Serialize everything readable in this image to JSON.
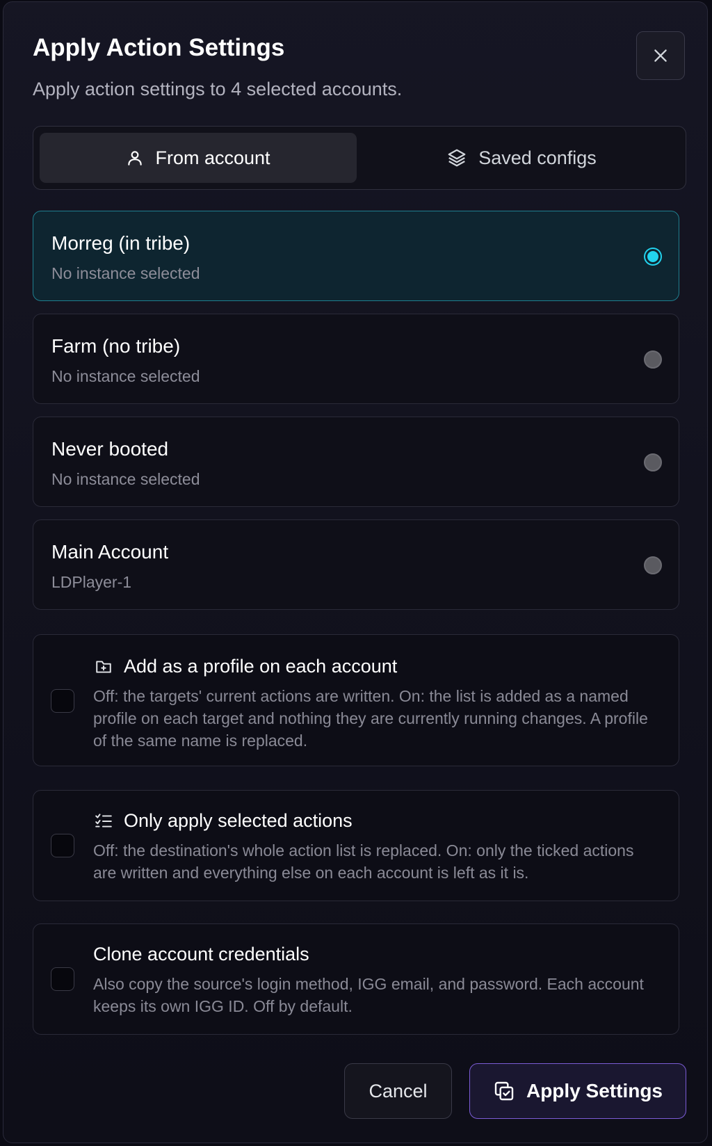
{
  "dialog": {
    "title": "Apply Action Settings",
    "subtitle": "Apply action settings to 4 selected accounts."
  },
  "tabs": [
    {
      "label": "From account",
      "icon": "user-icon",
      "active": true
    },
    {
      "label": "Saved configs",
      "icon": "layers-icon",
      "active": false
    }
  ],
  "accounts": [
    {
      "name": "Morreg (in tribe)",
      "instance": "No instance selected",
      "selected": true
    },
    {
      "name": "Farm (no tribe)",
      "instance": "No instance selected",
      "selected": false
    },
    {
      "name": "Never booted",
      "instance": "No instance selected",
      "selected": false
    },
    {
      "name": "Main Account",
      "instance": "LDPlayer-1",
      "selected": false
    }
  ],
  "options": [
    {
      "title": "Add as a profile on each account",
      "icon": "folder-plus-icon",
      "description": "Off: the targets' current actions are written. On: the list is added as a named profile on each target and nothing they are currently running changes. A profile of the same name is replaced.",
      "checked": false
    },
    {
      "title": "Only apply selected actions",
      "icon": "list-checks-icon",
      "description": "Off: the destination's whole action list is replaced. On: only the ticked actions are written and everything else on each account is left as it is.",
      "checked": false
    },
    {
      "title": "Clone account credentials",
      "description": "Also copy the source's login method, IGG email, and password. Each account keeps its own IGG ID. Off by default.",
      "checked": false
    }
  ],
  "footer": {
    "cancel_label": "Cancel",
    "apply_label": "Apply Settings",
    "apply_icon": "copy-check-icon"
  },
  "colors": {
    "accent_cyan": "#22d3ee",
    "accent_purple": "#7c5cd6",
    "background": "#0b0b14"
  }
}
